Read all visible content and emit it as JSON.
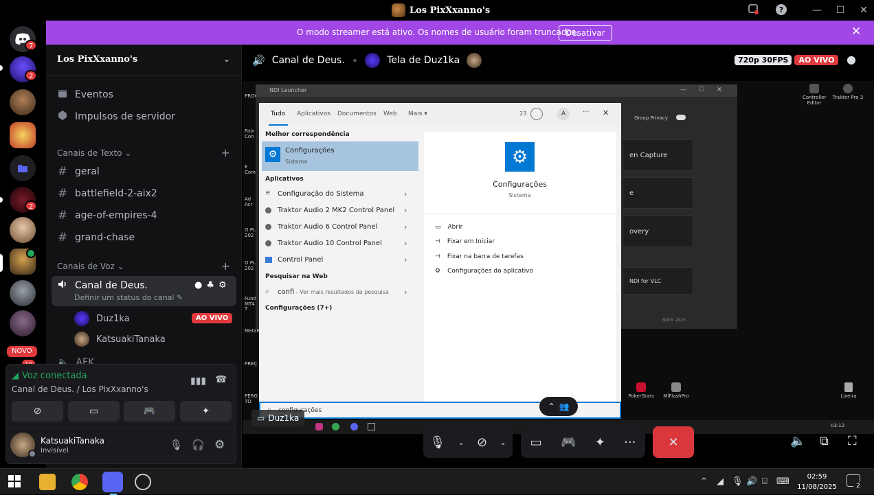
{
  "window": {
    "title": "Los PixXxanno's"
  },
  "banner": {
    "message": "O modo streamer está ativo. Os nomes de usuário foram truncados.",
    "button": "Desativar"
  },
  "servers": {
    "badges": [
      "7",
      "2",
      "2"
    ],
    "new_label": "NOVO",
    "partial_badge": "10"
  },
  "sidebar": {
    "server_name": "Los PixXxanno's",
    "items": [
      {
        "label": "Eventos",
        "icon": "calendar-icon"
      },
      {
        "label": "Impulsos de servidor",
        "icon": "boost-icon"
      }
    ],
    "text_category": "Canais de Texto",
    "text_channels": [
      "geral",
      "battlefield-2-aix2",
      "age-of-empires-4",
      "grand-chase"
    ],
    "voice_category": "Canais de Voz",
    "active_voice": {
      "name": "Canal de Deus.",
      "status": "Definir um status do canal"
    },
    "voice_users": [
      {
        "name": "Duz1ka",
        "live": "AO VIVO"
      },
      {
        "name": "KatsuakiTanaka"
      }
    ],
    "next_channel": "AFK"
  },
  "voice_panel": {
    "status": "Voz conectada",
    "location": "Canal de Deus. / Los PixXxanno's",
    "user": {
      "name": "KatsuakiTanaka",
      "status": "Invisível"
    }
  },
  "stage": {
    "channel": "Canal de Deus.",
    "stream_title": "Tela de Duz1ka",
    "quality": "720p 30FPS",
    "live": "AO VIVO",
    "streamer_tag": "Duz1ka"
  },
  "remote_screen": {
    "ndi_title": "NDI Launcher",
    "ndi_rows": [
      "en Capture",
      "e",
      "overy",
      "NDI for VLC"
    ],
    "ndi_footer": "NDI® 2025",
    "group_privacy": "Group Privacy",
    "desktop_icons_right": [
      {
        "label": "Controller Editor"
      },
      {
        "label": "Traktor Pro 3"
      },
      {
        "label": "PokerStars"
      },
      {
        "label": "MiFlashPro"
      },
      {
        "label": "Lixeira"
      }
    ],
    "desktop_icons_left": [
      "PROCES",
      "Pain Con",
      "E Comp",
      "Ad Acr",
      "O PL 202",
      "O PL 202",
      "Fund MT4 T",
      "MetaE",
      "PREÇ",
      "PERG TO"
    ],
    "search": {
      "tabs": [
        "Tudo",
        "Aplicativos",
        "Documentos",
        "Web",
        "Mais"
      ],
      "points": "23",
      "account": "A",
      "best_match_header": "Melhor correspondência",
      "best_match": {
        "title": "Configurações",
        "subtitle": "Sistema"
      },
      "apps_header": "Aplicativos",
      "apps": [
        "Configuração do Sistema",
        "Traktor Audio 2 MK2 Control Panel",
        "Traktor Audio 6 Control Panel",
        "Traktor Audio 10 Control Panel",
        "Control Panel"
      ],
      "web_header": "Pesquisar na Web",
      "web_query": "confi",
      "web_hint": " - Ver mais resultados da pesquisa",
      "settings_header": "Configurações (7+)",
      "preview": {
        "title": "Configurações",
        "subtitle": "Sistema"
      },
      "actions": [
        "Abrir",
        "Fixar em Iniciar",
        "Fixar na barra de tarefas",
        "Configurações do aplicativo"
      ],
      "input_value": "configurações"
    },
    "inner_clock": "03:12"
  },
  "taskbar": {
    "time": "02:59",
    "date": "11/08/2025",
    "notif_count": "2"
  }
}
